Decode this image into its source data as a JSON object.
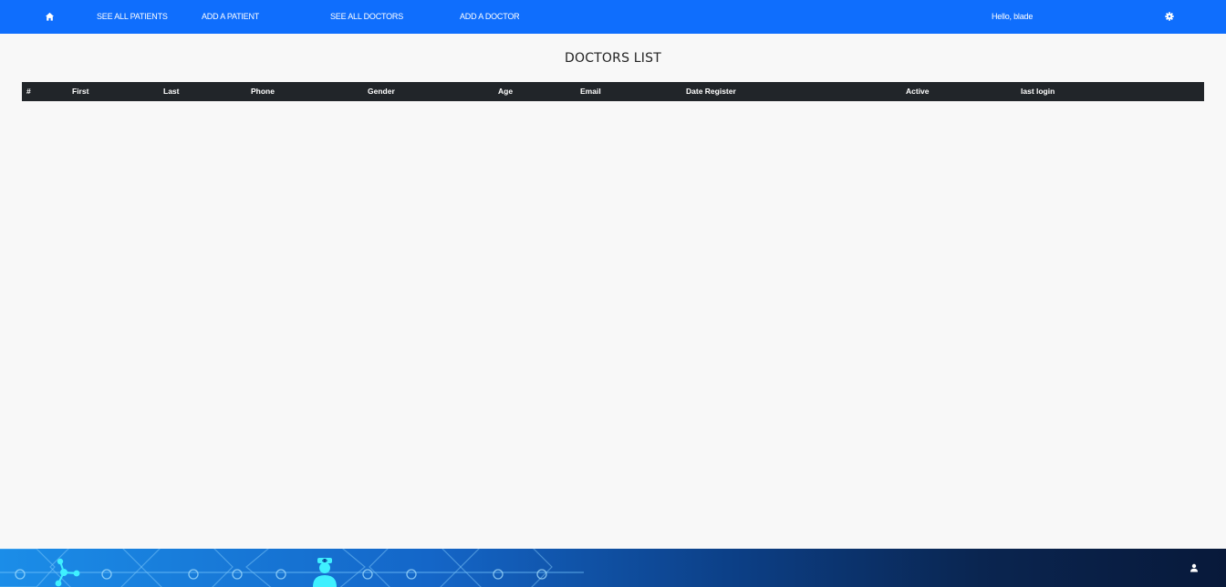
{
  "nav": {
    "home_icon": "home-icon",
    "see_all_patients": "SEE ALL PATIENTS",
    "add_patient": "ADD A PATIENT",
    "see_all_doctors": "SEE ALL DOCTORS",
    "add_doctor": "ADD A DOCTOR",
    "greeting": "Hello, blade",
    "settings_icon": "gear-icon",
    "bar_color": "#0f6efd"
  },
  "main": {
    "title": "DOCTORS LIST",
    "table": {
      "columns": [
        "#",
        "First",
        "Last",
        "Phone",
        "Gender",
        "Age",
        "Email",
        "Date Register",
        "Active",
        "last login"
      ],
      "rows": [],
      "header_color": "#212529"
    }
  },
  "footer": {
    "user_icon": "user-icon",
    "decoration_icons": [
      "molecule-icon",
      "doctor-icon"
    ]
  }
}
